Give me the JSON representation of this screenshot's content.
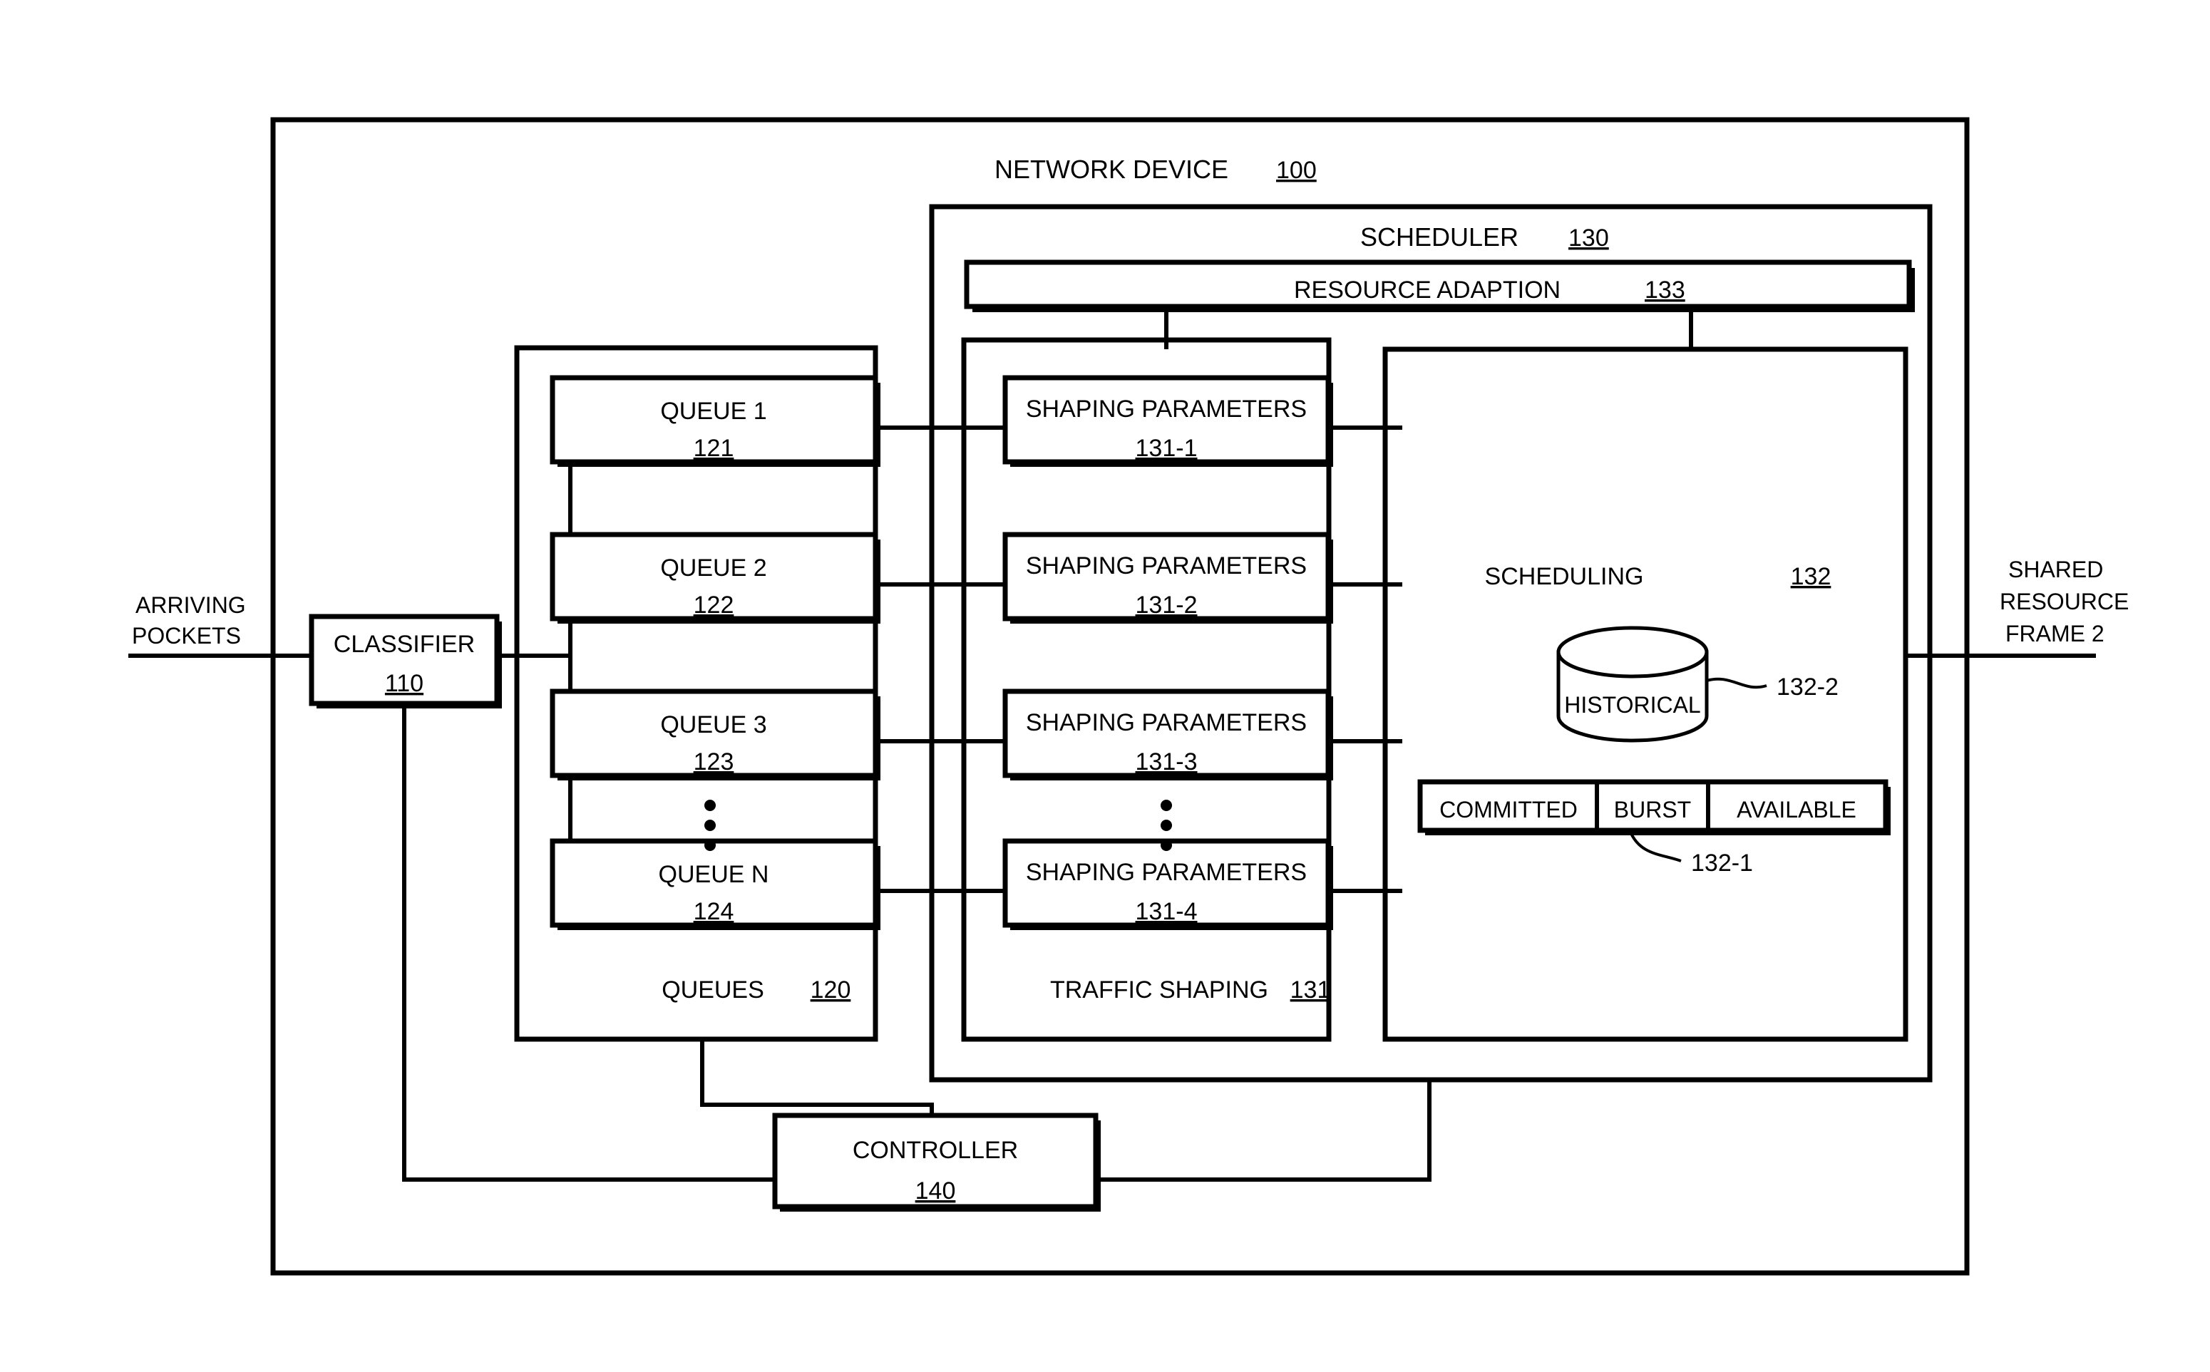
{
  "diagram": {
    "outer": {
      "title": "NETWORK DEVICE",
      "ref": "100"
    },
    "io": {
      "input_line1": "ARRIVING",
      "input_line2": "POCKETS",
      "output_line1": "SHARED",
      "output_line2": "RESOURCE",
      "output_line3": "FRAME 2"
    },
    "classifier": {
      "title": "CLASSIFIER",
      "ref": "110"
    },
    "controller": {
      "title": "CONTROLLER",
      "ref": "140"
    },
    "queues_group": {
      "title": "QUEUES",
      "ref": "120"
    },
    "queues": [
      {
        "title": "QUEUE 1",
        "ref": "121"
      },
      {
        "title": "QUEUE 2",
        "ref": "122"
      },
      {
        "title": "QUEUE 3",
        "ref": "123"
      },
      {
        "title": "QUEUE N",
        "ref": "124"
      }
    ],
    "scheduler": {
      "title": "SCHEDULER",
      "ref": "130"
    },
    "resource_adaption": {
      "title": "RESOURCE ADAPTION",
      "ref": "133"
    },
    "traffic_shaping_group": {
      "title": "TRAFFIC SHAPING",
      "ref": "131"
    },
    "shaping_parameters": [
      {
        "title": "SHAPING PARAMETERS",
        "ref": "131-1"
      },
      {
        "title": "SHAPING PARAMETERS",
        "ref": "131-2"
      },
      {
        "title": "SHAPING PARAMETERS",
        "ref": "131-3"
      },
      {
        "title": "SHAPING PARAMETERS",
        "ref": "131-4"
      }
    ],
    "scheduling": {
      "title": "SCHEDULING",
      "ref": "132",
      "database": {
        "label": "HISTORICAL",
        "callout": "132-2"
      },
      "resource_bar": {
        "callout": "132-1",
        "cells": [
          "COMMITTED",
          "BURST",
          "AVAILABLE"
        ]
      }
    }
  }
}
